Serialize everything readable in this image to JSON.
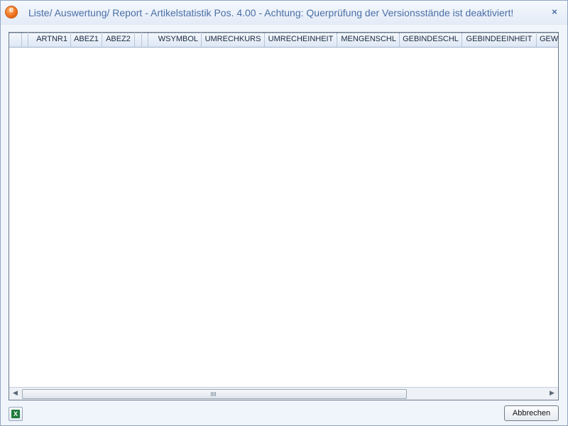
{
  "window": {
    "title": "Liste/ Auswertung/ Report - Artikelstatistik Pos. 4.00 - Achtung: Querprüfung der Versionsstände ist deaktiviert!",
    "app_icon_glyph": "e",
    "close_glyph": "×"
  },
  "grid": {
    "columns": [
      "ARTNR1",
      "ABEZ1",
      "ABEZ2",
      "",
      "WSYMBOL",
      "UMRECHKURS",
      "UMRECHEINHEIT",
      "MENGENSCHL",
      "GEBINDESCHL",
      "GEBINDEEINHEIT",
      "GEW"
    ],
    "rows": []
  },
  "scrollbar": {
    "left_arrow": "◀",
    "right_arrow": "▶"
  },
  "footer": {
    "excel_icon": "excel-export-icon",
    "excel_glyph": "X",
    "cancel_label": "Abbrechen"
  }
}
